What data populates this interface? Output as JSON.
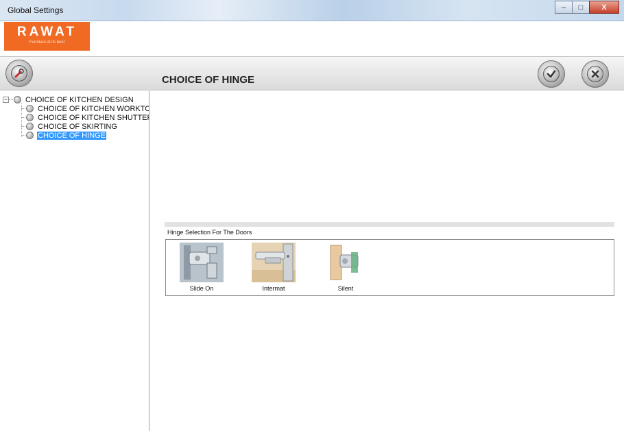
{
  "window": {
    "title": "Global Settings",
    "controls": {
      "minimize": "–",
      "maximize": "□",
      "close": "X"
    }
  },
  "logo": {
    "brand": "RAWAT",
    "tagline": "Furniture at its best",
    "color": "#f06a24"
  },
  "header": {
    "title": "CHOICE OF HINGE",
    "home_icon": "tools-icon",
    "ok_icon": "check-icon",
    "cancel_icon": "x-icon"
  },
  "tree": {
    "root": "CHOICE OF KITCHEN DESIGN",
    "items": [
      {
        "label": "CHOICE OF KITCHEN WORKTOP"
      },
      {
        "label": "CHOICE OF KITCHEN SHUTTER D"
      },
      {
        "label": "CHOICE OF SKIRTING"
      },
      {
        "label": "CHOICE OF HINGE",
        "selected": true
      }
    ],
    "selection_color": "#3399ff"
  },
  "hinge_selection": {
    "label": "Hinge Selection For The Doors",
    "options": [
      {
        "caption": "Slide On",
        "icon": "slide-on-hinge-icon"
      },
      {
        "caption": "Intermat",
        "icon": "intermat-hinge-icon"
      },
      {
        "caption": "Silent",
        "icon": "silent-hinge-icon"
      }
    ]
  }
}
